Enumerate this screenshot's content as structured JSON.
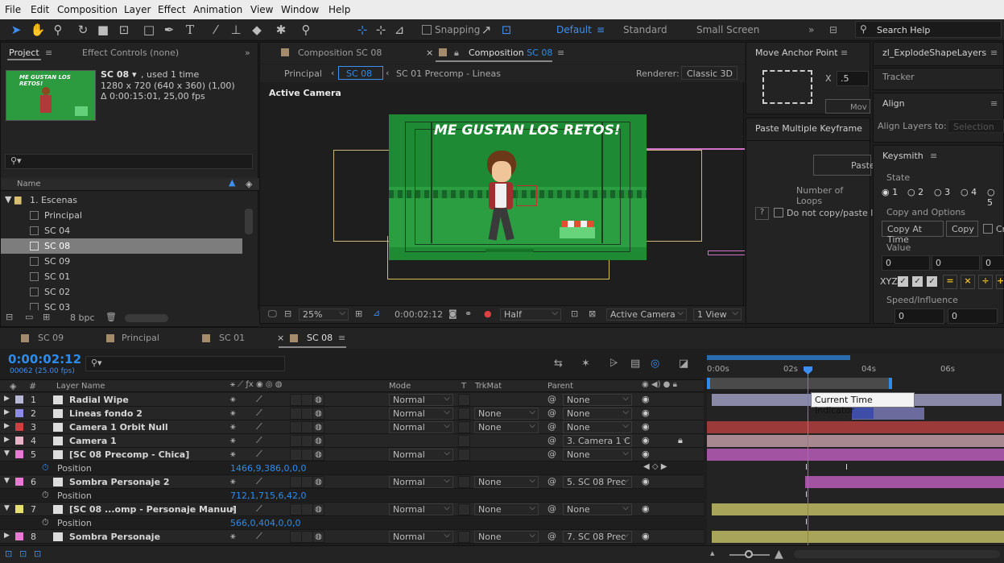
{
  "menu": [
    "File",
    "Edit",
    "Composition",
    "Layer",
    "Effect",
    "Animation",
    "View",
    "Window",
    "Help"
  ],
  "toolbar": {
    "snapping": "Snapping",
    "workspaces": [
      "Default",
      "Standard",
      "Small Screen"
    ],
    "search": "Search Help"
  },
  "project": {
    "tab": "Project",
    "tab2": "Effect Controls (none)",
    "thumb_text": "ME GUSTAN LOS RETOS!",
    "comp_name": "SC 08 ▾",
    "used": ", used 1 time",
    "res": "1280 x 720  (640 x 360) (1,00)",
    "dur": "Δ 0:00:15:01, 25,00 fps",
    "col_name": "Name",
    "folder": "1. Escenas",
    "items": [
      "Principal",
      "SC 04",
      "SC 08",
      "SC 09",
      "SC 01",
      "SC 02",
      "SC 03"
    ],
    "bpc": "8 bpc"
  },
  "comp": {
    "tab1": "Composition SC 08",
    "tab2": "Composition ",
    "tab2b": "SC 08",
    "crumbs": [
      "Principal",
      "SC 08",
      "SC 01 Precomp - Lineas"
    ],
    "renderer_label": "Renderer:",
    "renderer": "Classic 3D",
    "camera_label": "Active Camera",
    "title_text": "ME GUSTAN LOS RETOS!",
    "zoom": "25%",
    "time": "0:00:02:12",
    "quality": "Half",
    "view": "Active Camera",
    "views": "1 View"
  },
  "move_anchor": {
    "title": "Move Anchor Point",
    "x_label": "X",
    "x_value": ".5",
    "btn": "Mov"
  },
  "paste_kf": {
    "title": "Paste Multiple Keyframe",
    "paste": "Paste",
    "loops": "Number of Loops",
    "nocopy": "Do not copy/paste l",
    "help": "?"
  },
  "right": {
    "explode": "zl_ExplodeShapeLayers",
    "tracker": "Tracker",
    "align": "Align",
    "align_to": "Align Layers to:",
    "align_sel": "Selection",
    "keysmith": "Keysmith",
    "state": "State",
    "states": [
      "1",
      "2",
      "3",
      "4",
      "5"
    ],
    "copy_opts": "Copy and Options",
    "copy_at": "Copy At Time",
    "copy": "Copy",
    "cr": "Cr",
    "value": "Value",
    "values": [
      "0",
      "0",
      "0"
    ],
    "xyz": "XYZ",
    "speed": "Speed/Influence",
    "speeds": [
      "0",
      "0"
    ]
  },
  "timeline": {
    "tabs": [
      "SC 09",
      "Principal",
      "SC 01",
      "SC 08"
    ],
    "time": "0:00:02:12",
    "frames": "00062 (25.00 fps)",
    "cols": {
      "name": "Layer Name",
      "mode": "Mode",
      "t": "T",
      "trkmat": "TrkMat",
      "parent": "Parent"
    },
    "ruler": [
      "0:00s",
      "02s",
      "04s",
      "06s"
    ],
    "tooltip": "Current Time Indicator",
    "layers": [
      {
        "n": "1",
        "name": "Radial Wipe",
        "mode": "Normal",
        "trk": "",
        "parent": "None",
        "color": "#b7b7d6"
      },
      {
        "n": "2",
        "name": "Lineas fondo 2",
        "mode": "Normal",
        "trk": "None",
        "parent": "None",
        "color": "#8c8ce6"
      },
      {
        "n": "3",
        "name": "Camera 1 Orbit Null",
        "mode": "Normal",
        "trk": "None",
        "parent": "None",
        "color": "#d04040"
      },
      {
        "n": "4",
        "name": "Camera 1",
        "mode": "",
        "trk": "",
        "parent": "3. Camera 1 C",
        "color": "#e8b4c8"
      },
      {
        "n": "5",
        "name": "[SC 08 Precomp - Chica]",
        "mode": "Normal",
        "trk": "",
        "parent": "None",
        "color": "#e87ad4"
      },
      {
        "n": "6",
        "name": "Sombra Personaje 2",
        "mode": "Normal",
        "trk": "None",
        "parent": "5. SC 08 Prec",
        "color": "#e87ad4"
      },
      {
        "n": "7",
        "name": "[SC 08 ...omp - Personaje Manuu]",
        "mode": "Normal",
        "trk": "None",
        "parent": "None",
        "color": "#e6e070"
      },
      {
        "n": "8",
        "name": "Sombra Personaje",
        "mode": "Normal",
        "trk": "None",
        "parent": "7. SC 08 Prec",
        "color": "#e87ad4"
      }
    ],
    "props": [
      {
        "name": "Position",
        "value": "1466,9,386,0,0,0"
      },
      {
        "name": "Position",
        "value": "712,1,715,6,42,0"
      },
      {
        "name": "Position",
        "value": "566,0,404,0,0,0"
      }
    ]
  }
}
